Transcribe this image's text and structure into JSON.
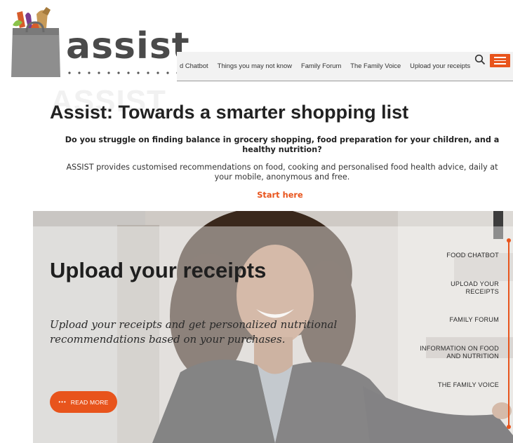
{
  "logo": {
    "text": "assist"
  },
  "nav": {
    "items": [
      {
        "label": "d Chatbot"
      },
      {
        "label": "Things you may not know"
      },
      {
        "label": "Family Forum"
      },
      {
        "label": "The Family Voice"
      },
      {
        "label": "Upload your receipts"
      }
    ],
    "search_icon": "search-icon",
    "menu_icon": "hamburger-icon"
  },
  "intro": {
    "ghost_text": "ASSIST",
    "title": "Assist: Towards a smarter shopping list",
    "question": "Do you struggle on finding balance in grocery shopping, food preparation for your children, and a healthy nutrition?",
    "description": "ASSIST provides customised recommendations on food, cooking and personalised food health advice, daily at your mobile, anonymous and free.",
    "start_label": "Start here"
  },
  "hero": {
    "title": "Upload your receipts",
    "description": "Upload your receipts and get personalized nutritional recommendations based on your purchases.",
    "read_more_label": "READ MORE",
    "read_more_dots": "•••",
    "side_nav": [
      {
        "label": "FOOD CHATBOT"
      },
      {
        "label": "UPLOAD YOUR RECEIPTS"
      },
      {
        "label": "FAMILY FORUM"
      },
      {
        "label": "INFORMATION ON FOOD AND NUTRITION"
      },
      {
        "label": "THE FAMILY VOICE"
      }
    ]
  },
  "colors": {
    "accent": "#e8541c",
    "text_dark": "#222222",
    "logo_gray": "#4a4a4a"
  }
}
